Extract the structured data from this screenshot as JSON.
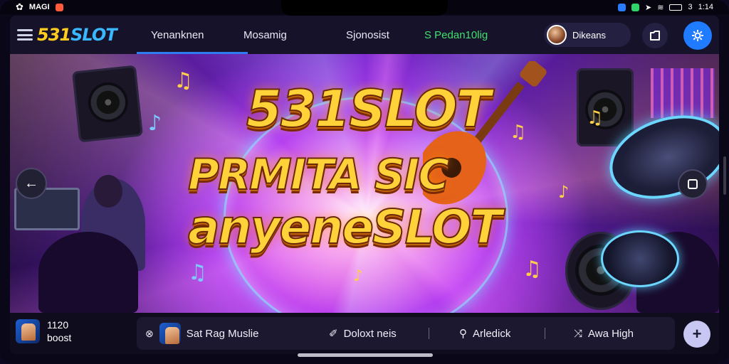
{
  "status": {
    "left_text": "MAGI",
    "time": "1:14",
    "battery_text": "3"
  },
  "brand": {
    "name_part1": "531",
    "name_part2": "SLOT"
  },
  "nav": {
    "tabs": [
      {
        "label": "Yenanknen",
        "active": true
      },
      {
        "label": "Mosamig",
        "active": false
      },
      {
        "label": "Sjonosist",
        "active": false
      },
      {
        "label": "S Pedan10lig",
        "active": false
      }
    ],
    "user_name": "Dikeans"
  },
  "hero": {
    "title_line1": "531SLOT",
    "title_line2": "PRMITA SIC",
    "title_line3": "anyeneSLOT"
  },
  "now_playing": {
    "time": "1120",
    "label": "boost"
  },
  "player": {
    "items": [
      {
        "label": "Sat Rag Muslie",
        "icon": "close-icon"
      },
      {
        "label": "Doloxt neis",
        "icon": "pen-icon"
      },
      {
        "label": "Arledick",
        "icon": "search-icon"
      },
      {
        "label": "Awa High",
        "icon": "shuffle-icon"
      }
    ],
    "action_symbol": "+"
  },
  "colors": {
    "accent_blue": "#1f7bff",
    "brand_yellow": "#ffcc1f",
    "brand_cyan": "#39b7ff",
    "tab_green": "#3fe06e"
  }
}
